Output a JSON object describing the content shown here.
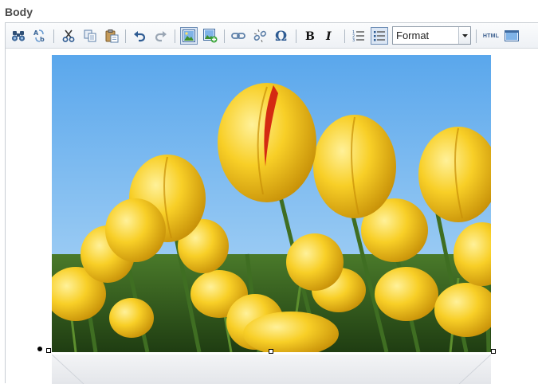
{
  "section": {
    "label": "Body"
  },
  "toolbar": {
    "format_select": {
      "value": "Format"
    },
    "html_button": {
      "label": "HTML"
    }
  },
  "icons": {
    "find": "binoculars-icon",
    "replace": "find-replace-icon",
    "cut": "scissors-icon",
    "copy": "copy-icon",
    "paste": "paste-icon",
    "undo": "undo-icon",
    "redo": "redo-icon",
    "image": "image-icon",
    "image_manager": "image-add-icon",
    "link": "link-icon",
    "unlink": "unlink-icon",
    "special_char": "omega-icon",
    "bold": "bold-icon",
    "italic": "italic-icon",
    "ordered_list": "ordered-list-icon",
    "unordered_list": "unordered-list-icon",
    "preview": "preview-icon"
  },
  "colors": {
    "accent": "#3c5f8f",
    "active_border": "#6f8fb7",
    "active_bg": "#dbe6f4"
  }
}
